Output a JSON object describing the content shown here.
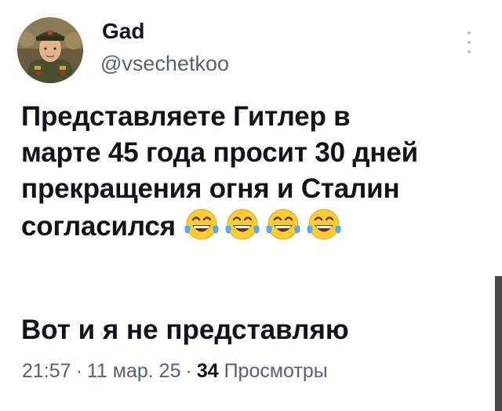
{
  "author": {
    "name": "Gad",
    "handle": "@vsechetkoo",
    "avatar_icon": "avatar-portrait"
  },
  "tweet": {
    "lines": [
      "Представляете Гитлер в",
      "марте 45 года просит 30 дней",
      "прекращения огня и Сталин",
      "согласился"
    ],
    "emoji": [
      "face-with-tears-of-joy",
      "face-with-tears-of-joy",
      "face-with-tears-of-joy",
      "face-with-tears-of-joy"
    ],
    "second_paragraph": "Вот и я не представляю"
  },
  "meta": {
    "time": "21:57",
    "separator": "·",
    "date": "11 мар. 25",
    "views_count": "34",
    "views_label": "Просмотры"
  },
  "colors": {
    "text": "#0f1419",
    "secondary": "#536471",
    "emoji_face": "#ffcc33",
    "tears": "#5fa8e8"
  }
}
